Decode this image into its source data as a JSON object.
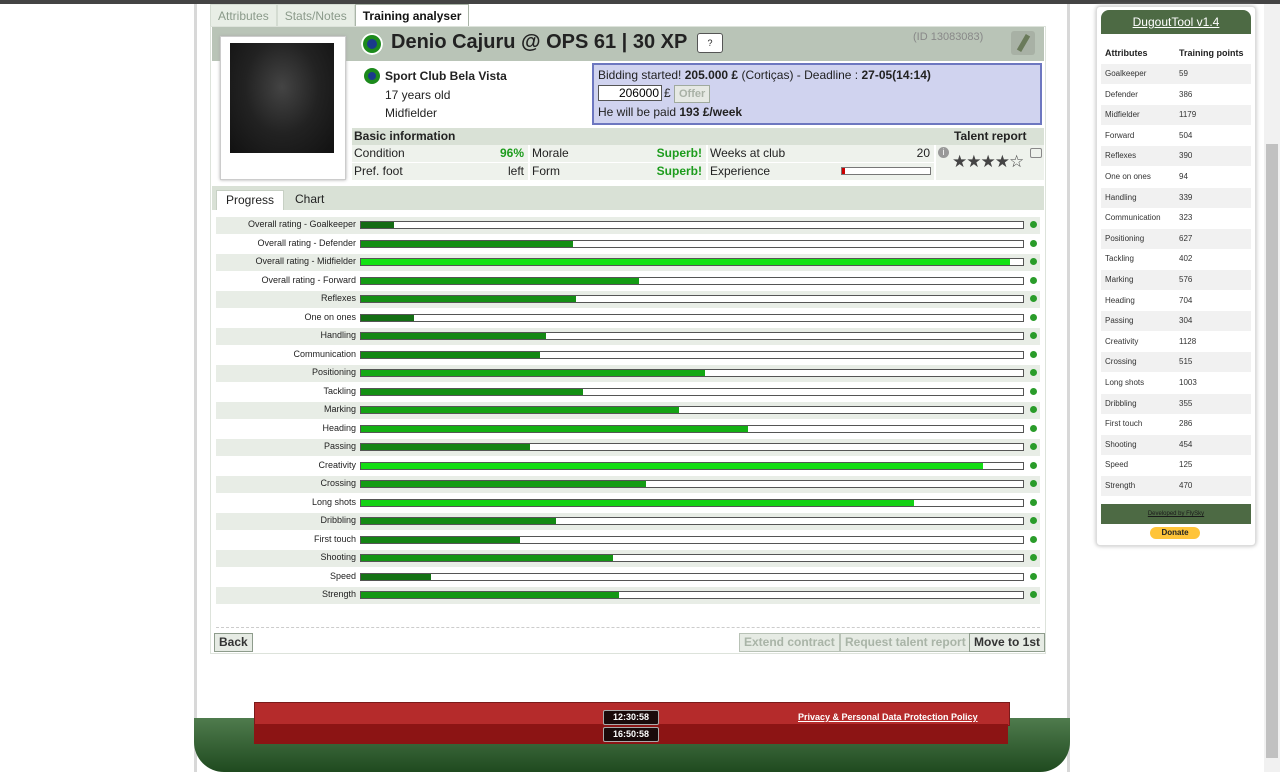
{
  "tabs": [
    "Attributes",
    "Stats/Notes",
    "Training analyser"
  ],
  "player": {
    "name": "Denio Cajuru @ OPS 61 | 30 XP",
    "shirt_label": "?",
    "id": "(ID 13083083)",
    "club": "Sport Club Bela Vista",
    "age": "17 years old",
    "position": "Midfielder"
  },
  "bid": {
    "line1_pre": "Bidding started! ",
    "amount": "205.000 £",
    "line1_mid": " (Cortiças) - Deadline : ",
    "deadline": "27-05(14:14)",
    "input_value": "206000",
    "currency": "£",
    "offer_label": "Offer",
    "wage_pre": "He will be paid ",
    "wage": "193 £/week"
  },
  "basic": {
    "title": "Basic information",
    "talent_title": "Talent report",
    "condition_label": "Condition",
    "condition": "96%",
    "morale_label": "Morale",
    "morale": "Superb!",
    "weeks_label": "Weeks at club",
    "weeks": "20",
    "foot_label": "Pref. foot",
    "foot": "left",
    "form_label": "Form",
    "form": "Superb!",
    "experience_label": "Experience",
    "stars": "★★★★☆"
  },
  "subtabs": [
    "Progress",
    "Chart"
  ],
  "progress": [
    {
      "label": "Overall rating - Goalkeeper",
      "value": 0.05
    },
    {
      "label": "Overall rating - Defender",
      "value": 0.32
    },
    {
      "label": "Overall rating - Midfielder",
      "value": 0.98
    },
    {
      "label": "Overall rating - Forward",
      "value": 0.42
    },
    {
      "label": "Reflexes",
      "value": 0.325
    },
    {
      "label": "One on ones",
      "value": 0.08
    },
    {
      "label": "Handling",
      "value": 0.28
    },
    {
      "label": "Communication",
      "value": 0.27
    },
    {
      "label": "Positioning",
      "value": 0.52
    },
    {
      "label": "Tackling",
      "value": 0.335
    },
    {
      "label": "Marking",
      "value": 0.48
    },
    {
      "label": "Heading",
      "value": 0.585
    },
    {
      "label": "Passing",
      "value": 0.255
    },
    {
      "label": "Creativity",
      "value": 0.94
    },
    {
      "label": "Crossing",
      "value": 0.43
    },
    {
      "label": "Long shots",
      "value": 0.835
    },
    {
      "label": "Dribbling",
      "value": 0.295
    },
    {
      "label": "First touch",
      "value": 0.24
    },
    {
      "label": "Shooting",
      "value": 0.38
    },
    {
      "label": "Speed",
      "value": 0.105
    },
    {
      "label": "Strength",
      "value": 0.39
    }
  ],
  "buttons": {
    "back": "Back",
    "extend": "Extend contract",
    "request": "Request talent report",
    "move": "Move to 1st"
  },
  "footer": {
    "clock1": "12:30:58",
    "clock2": "16:50:58",
    "privacy": "Privacy & Personal Data Protection Policy"
  },
  "dugout": {
    "title": "DugoutTool v1.4",
    "col_a": "Attributes",
    "col_b": "Training points",
    "rows": [
      [
        "Goalkeeper",
        "59"
      ],
      [
        "Defender",
        "386"
      ],
      [
        "Midfielder",
        "1179"
      ],
      [
        "Forward",
        "504"
      ],
      [
        "Reflexes",
        "390"
      ],
      [
        "One on ones",
        "94"
      ],
      [
        "Handling",
        "339"
      ],
      [
        "Communication",
        "323"
      ],
      [
        "Positioning",
        "627"
      ],
      [
        "Tackling",
        "402"
      ],
      [
        "Marking",
        "576"
      ],
      [
        "Heading",
        "704"
      ],
      [
        "Passing",
        "304"
      ],
      [
        "Creativity",
        "1128"
      ],
      [
        "Crossing",
        "515"
      ],
      [
        "Long shots",
        "1003"
      ],
      [
        "Dribbling",
        "355"
      ],
      [
        "First touch",
        "286"
      ],
      [
        "Shooting",
        "454"
      ],
      [
        "Speed",
        "125"
      ],
      [
        "Strength",
        "470"
      ]
    ],
    "developed": "Developed by FlySky",
    "donate": "Donate"
  }
}
